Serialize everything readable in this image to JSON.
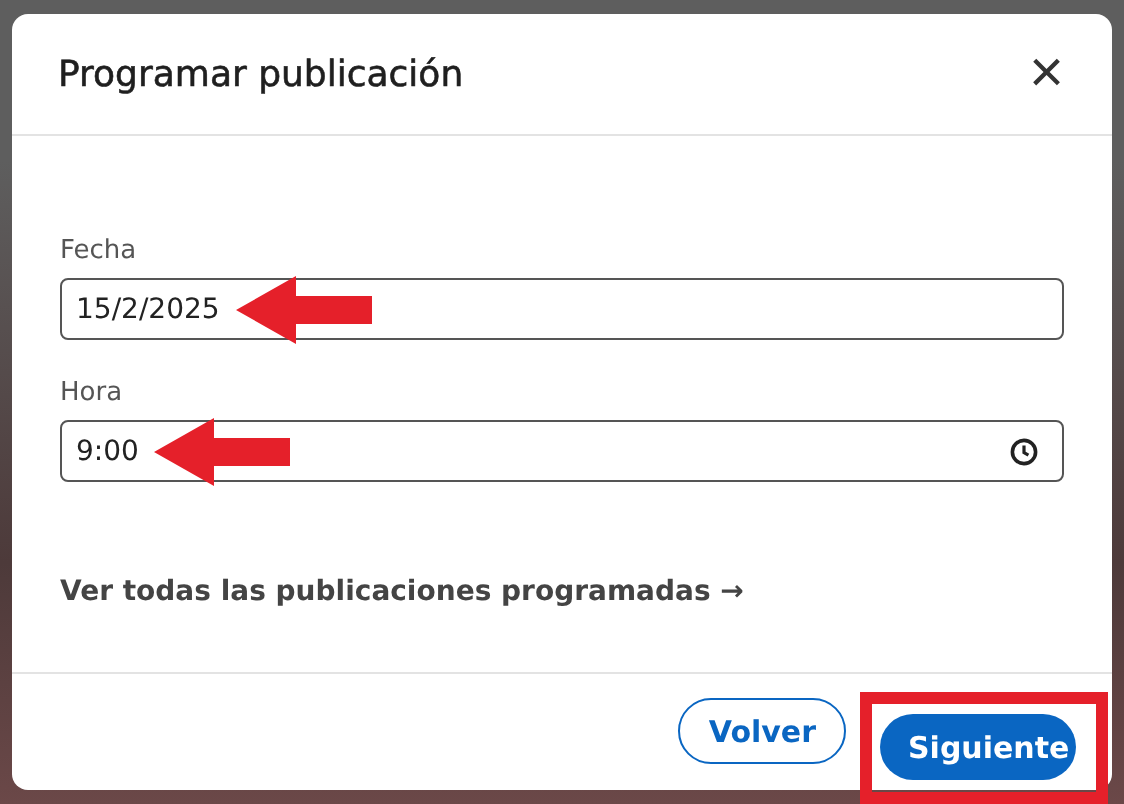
{
  "dialog": {
    "title": "Programar publicación",
    "close": "×"
  },
  "fields": [
    {
      "kind": "date",
      "label": "Fecha",
      "value": "15/2/2025",
      "arrow": true
    },
    {
      "kind": "time",
      "label": "Hora",
      "value": "9:00",
      "arrow": true
    }
  ],
  "link": {
    "label": "Ver todas las publicaciones programadas",
    "arrow": "→"
  },
  "buttons": [
    {
      "kind": "secondary",
      "label": "Volver",
      "highlighted": false
    },
    {
      "kind": "primary",
      "label": "Siguiente",
      "highlighted": true
    }
  ]
}
